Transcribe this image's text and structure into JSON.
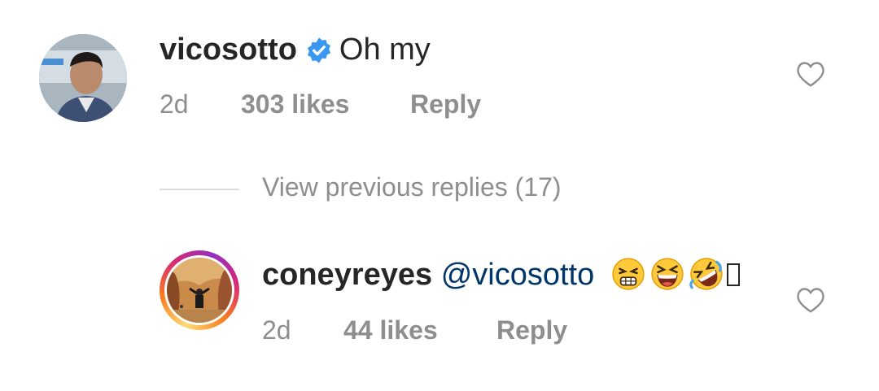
{
  "comments": [
    {
      "username": "vicosotto",
      "verified": true,
      "text": "Oh my",
      "time": "2d",
      "likes": "303 likes",
      "reply_label": "Reply"
    },
    {
      "username": "coneyreyes",
      "mention": "@vicosotto",
      "emojis": [
        "grimacing-squint-emoji",
        "laughing-squint-emoji",
        "rolling-laughing-emoji"
      ],
      "time": "2d",
      "likes": "44 likes",
      "reply_label": "Reply"
    }
  ],
  "view_previous_replies": "View previous replies (17)",
  "colors": {
    "text": "#262626",
    "secondary": "#8e8e8e",
    "mention": "#003569",
    "verified": "#3897f0"
  }
}
